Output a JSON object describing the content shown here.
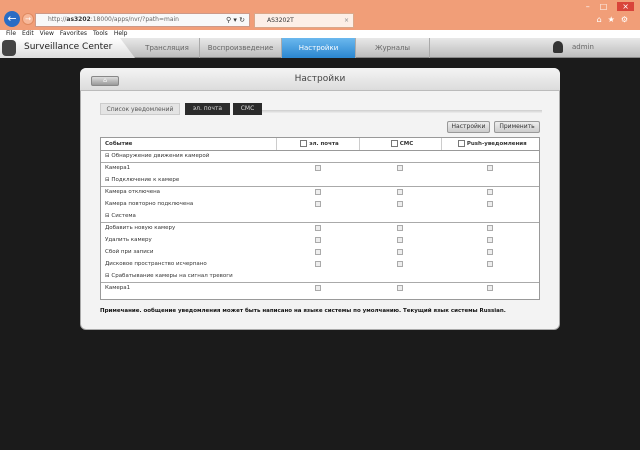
{
  "browser": {
    "url_prefix": "http://",
    "url_host": "as3202",
    "url_rest": ":18000/apps/nvr/?path=main",
    "addr_controls": "⚲ ▾ ↻",
    "tab_title": "AS3202T",
    "tab_close": "×",
    "win_controls": [
      "–",
      "□",
      "×"
    ],
    "nav_icons": "⌂★⚙"
  },
  "menu": [
    "File",
    "Edit",
    "View",
    "Favorites",
    "Tools",
    "Help"
  ],
  "app": {
    "title": "Surveillance Center",
    "nav": [
      "Трансляция",
      "Воспроизведение",
      "Настройки",
      "Журналы"
    ],
    "user": "admin"
  },
  "panel": {
    "title": "Настройки",
    "home": "⌂",
    "tabs": [
      "Список уведомлений",
      "эл. почта",
      "СМС"
    ],
    "buttons": {
      "settings": "Настройки",
      "apply": "Применить"
    }
  },
  "table": {
    "headers": [
      "Событие",
      "эл. почта",
      "СМС",
      "Push-уведомления"
    ],
    "groups": [
      {
        "name": "Обнаружение движения камерой",
        "rows": [
          "Камера1"
        ]
      },
      {
        "name": "Подключение к камере",
        "rows": [
          "Камера отключена",
          "Камера повторно подключена"
        ]
      },
      {
        "name": "Система",
        "rows": [
          "Добавить новую камеру",
          "Удалить камеру",
          "Сбой при записи",
          "Дисковое пространство исчерпано"
        ]
      },
      {
        "name": "Срабатывание камеры на сигнал тревоги",
        "rows": [
          "Камера1"
        ]
      }
    ],
    "group_marker": "⊟"
  },
  "note": "Примечание. ообщение уведомления может быть написано на языке системы по умолчанию. Текущий язык системы Russian."
}
